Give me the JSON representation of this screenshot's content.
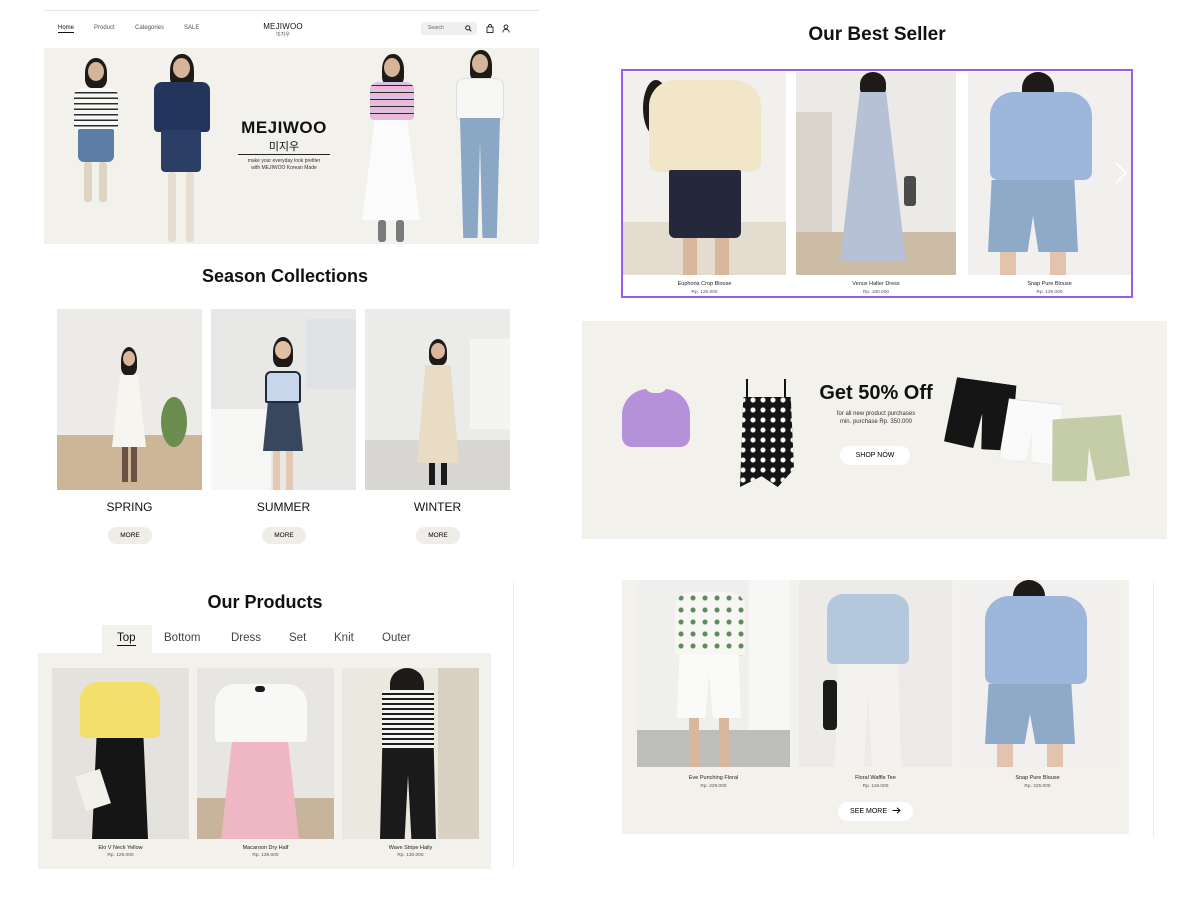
{
  "header": {
    "nav": [
      "Home",
      "Product",
      "Categories",
      "SALE"
    ],
    "logo": "MEJIWOO",
    "logo_sub": "미지우",
    "search_placeholder": "Search",
    "icons": [
      "search-icon",
      "bag-icon",
      "user-icon"
    ]
  },
  "hero": {
    "title": "MEJIWOO",
    "subtitle": "미지우",
    "tagline_line1": "make your everyday look prettier",
    "tagline_line2": "with MEJIWOO Korean Made"
  },
  "season": {
    "title": "Season Collections",
    "cards": [
      {
        "label": "SPRING",
        "button": "MORE"
      },
      {
        "label": "SUMMER",
        "button": "MORE"
      },
      {
        "label": "WINTER",
        "button": "MORE"
      }
    ]
  },
  "products": {
    "title": "Our Products",
    "tabs": [
      "Top",
      "Bottom",
      "Dress",
      "Set",
      "Knit",
      "Outer"
    ],
    "active_tab": "Top",
    "items": [
      {
        "name": "Elo V Neck Yellow",
        "price": "Rp. 129.000"
      },
      {
        "name": "Macaroon Dry Half",
        "price": "Rp. 139.000"
      },
      {
        "name": "Wave Stripe Haily",
        "price": "Rp. 130.000"
      }
    ]
  },
  "best_seller": {
    "title": "Our Best Seller",
    "items": [
      {
        "name": "Euphoria Crop Blouse",
        "price": "Rp. 125.000"
      },
      {
        "name": "Venus Halter Dress",
        "price": "Rp. 180.000"
      },
      {
        "name": "Snap Pure Blouse",
        "price": "Rp. 129.000"
      }
    ],
    "accent": "#9a5cf0"
  },
  "promo": {
    "title": "Get 50% Off",
    "desc_line1": "for all new product purchases",
    "desc_line2": "min. purchase Rp. 350.000",
    "button": "SHOP NOW"
  },
  "new_products": {
    "items": [
      {
        "name": "Eve Punching Floral",
        "price": "Rp. 229.000"
      },
      {
        "name": "Floral Waffle Tee",
        "price": "Rp. 119.000"
      },
      {
        "name": "Snap Pure Blouse",
        "price": "Rp. 225.000"
      }
    ],
    "button": "SEE MORE"
  },
  "colors": {
    "beige": "#f3f1ec",
    "text": "#111111",
    "accent": "#9a5cf0"
  }
}
